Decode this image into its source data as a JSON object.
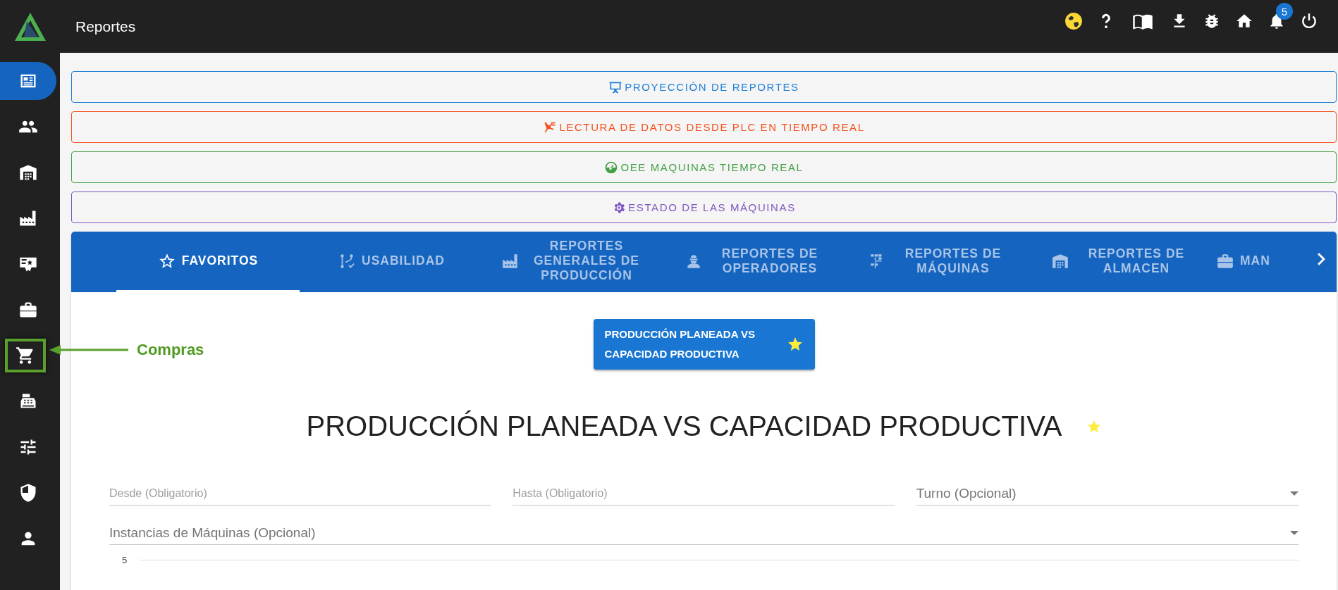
{
  "app": {
    "title": "Reportes"
  },
  "toolbar": {
    "notification_count": "5"
  },
  "sidebar": {
    "items": [
      {
        "selected": true,
        "highlighted": false
      },
      {
        "selected": false,
        "highlighted": false
      },
      {
        "selected": false,
        "highlighted": false
      },
      {
        "selected": false,
        "highlighted": false
      },
      {
        "selected": false,
        "highlighted": false
      },
      {
        "selected": false,
        "highlighted": false
      },
      {
        "selected": false,
        "highlighted": true
      },
      {
        "selected": false,
        "highlighted": false
      },
      {
        "selected": false,
        "highlighted": false
      },
      {
        "selected": false,
        "highlighted": false
      },
      {
        "selected": false,
        "highlighted": false
      }
    ]
  },
  "annotation": {
    "label": "Compras"
  },
  "report_links": [
    {
      "label": "PROYECCIÓN DE REPORTES",
      "color": "#1e7fd8"
    },
    {
      "label": "LECTURA DE DATOS DESDE PLC EN TIEMPO REAL",
      "color": "#f4511e"
    },
    {
      "label": "OEE MAQUINAS TIEMPO REAL",
      "color": "#43a047"
    },
    {
      "label": "ESTADO DE LAS MÁQUINAS",
      "color": "#7e57c2"
    }
  ],
  "tabs": [
    {
      "label": "FAVORITOS",
      "selected": true
    },
    {
      "label": "USABILIDAD",
      "selected": false
    },
    {
      "label": "REPORTES GENERALES DE PRODUCCIÓN",
      "selected": false
    },
    {
      "label": "REPORTES DE OPERADORES",
      "selected": false
    },
    {
      "label": "REPORTES DE MÁQUINAS",
      "selected": false
    },
    {
      "label": "REPORTES DE ALMACEN",
      "selected": false
    },
    {
      "label": "MAN",
      "selected": false
    }
  ],
  "favorites": [
    {
      "label": "PRODUCCIÓN PLANEADA VS CAPACIDAD PRODUCTIVA",
      "favorite": true
    }
  ],
  "report": {
    "title": "PRODUCCIÓN PLANEADA VS CAPACIDAD PRODUCTIVA",
    "favorite": true
  },
  "filters": [
    {
      "kind": "date",
      "placeholder": "Desde (Obligatorio)"
    },
    {
      "kind": "date",
      "placeholder": "Hasta (Obligatorio)"
    },
    {
      "kind": "select",
      "placeholder": "Turno (Opcional)"
    },
    {
      "kind": "select",
      "placeholder": "Instancias de Máquinas (Opcional)"
    }
  ],
  "chart": {
    "tick_labels": [
      "5"
    ]
  }
}
